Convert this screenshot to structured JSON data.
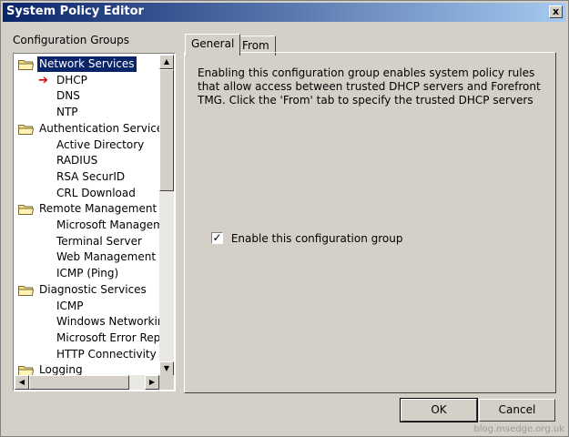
{
  "window": {
    "title": "System Policy Editor",
    "close_glyph": "x"
  },
  "left": {
    "label": "Configuration Groups",
    "tree": [
      {
        "label": "Network Services",
        "level": 0,
        "icon": "folder-icon",
        "selected": true
      },
      {
        "label": "DHCP",
        "level": 1,
        "marker": "red-arrow-icon"
      },
      {
        "label": "DNS",
        "level": 1
      },
      {
        "label": "NTP",
        "level": 1
      },
      {
        "label": "Authentication Services",
        "level": 0,
        "icon": "folder-icon"
      },
      {
        "label": "Active Directory",
        "level": 1
      },
      {
        "label": "RADIUS",
        "level": 1
      },
      {
        "label": "RSA SecurID",
        "level": 1
      },
      {
        "label": "CRL Download",
        "level": 1
      },
      {
        "label": "Remote Management",
        "level": 0,
        "icon": "folder-icon"
      },
      {
        "label": "Microsoft Manageme",
        "level": 1
      },
      {
        "label": "Terminal Server",
        "level": 1
      },
      {
        "label": "Web Management",
        "level": 1
      },
      {
        "label": "ICMP (Ping)",
        "level": 1
      },
      {
        "label": "Diagnostic Services",
        "level": 0,
        "icon": "folder-icon"
      },
      {
        "label": "ICMP",
        "level": 1
      },
      {
        "label": "Windows Networking",
        "level": 1
      },
      {
        "label": "Microsoft Error Repo",
        "level": 1
      },
      {
        "label": "HTTP Connectivity v",
        "level": 1
      },
      {
        "label": "Logging",
        "level": 0,
        "icon": "folder-icon"
      }
    ]
  },
  "tabs": [
    {
      "label": "General",
      "active": true
    },
    {
      "label": "From",
      "active": false
    }
  ],
  "general": {
    "description": "Enabling this configuration group enables system policy rules that allow access between trusted DHCP servers and Forefront TMG. Click the 'From' tab to specify the trusted DHCP servers",
    "checkbox_label": "Enable this configuration group",
    "checkbox_checked": true
  },
  "buttons": {
    "ok": "OK",
    "cancel": "Cancel"
  },
  "watermark": "blog.msedge.org.uk",
  "colors": {
    "title_start": "#0a246a",
    "title_end": "#a6caf0",
    "selection": "#0a246a",
    "dialog_bg": "#d4d0c8"
  }
}
